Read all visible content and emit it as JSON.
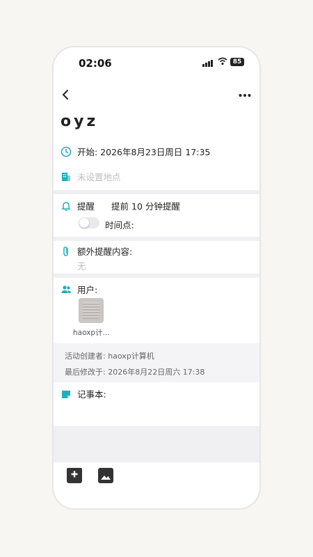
{
  "status_bar": {
    "time": "02:06",
    "battery": "85"
  },
  "nav": {
    "back_icon": "chevron-left-icon",
    "more_icon": "more-dots-icon"
  },
  "event": {
    "title": "oyz",
    "start": "开始: 2026年8月23日周日 17:35",
    "location_placeholder": "未设置地点",
    "reminder_label": "提醒",
    "reminder_value": "提前 10 分钟提醒",
    "timepoint_label": "时间点:",
    "extra_label": "额外提醒内容:",
    "extra_value": "无",
    "users_label": "用户:",
    "user_name": "haoxp计...",
    "creator": "活动创建者: haoxp计算机",
    "modified": "最后修改于:  2026年8月22日周六 17:38",
    "notebook_label": "记事本:"
  },
  "toolbar": {
    "add_comment_icon": "add-comment-icon",
    "image_icon": "image-icon"
  },
  "colors": {
    "accent": "#23aeb8",
    "separator": "#f0f0f3"
  }
}
